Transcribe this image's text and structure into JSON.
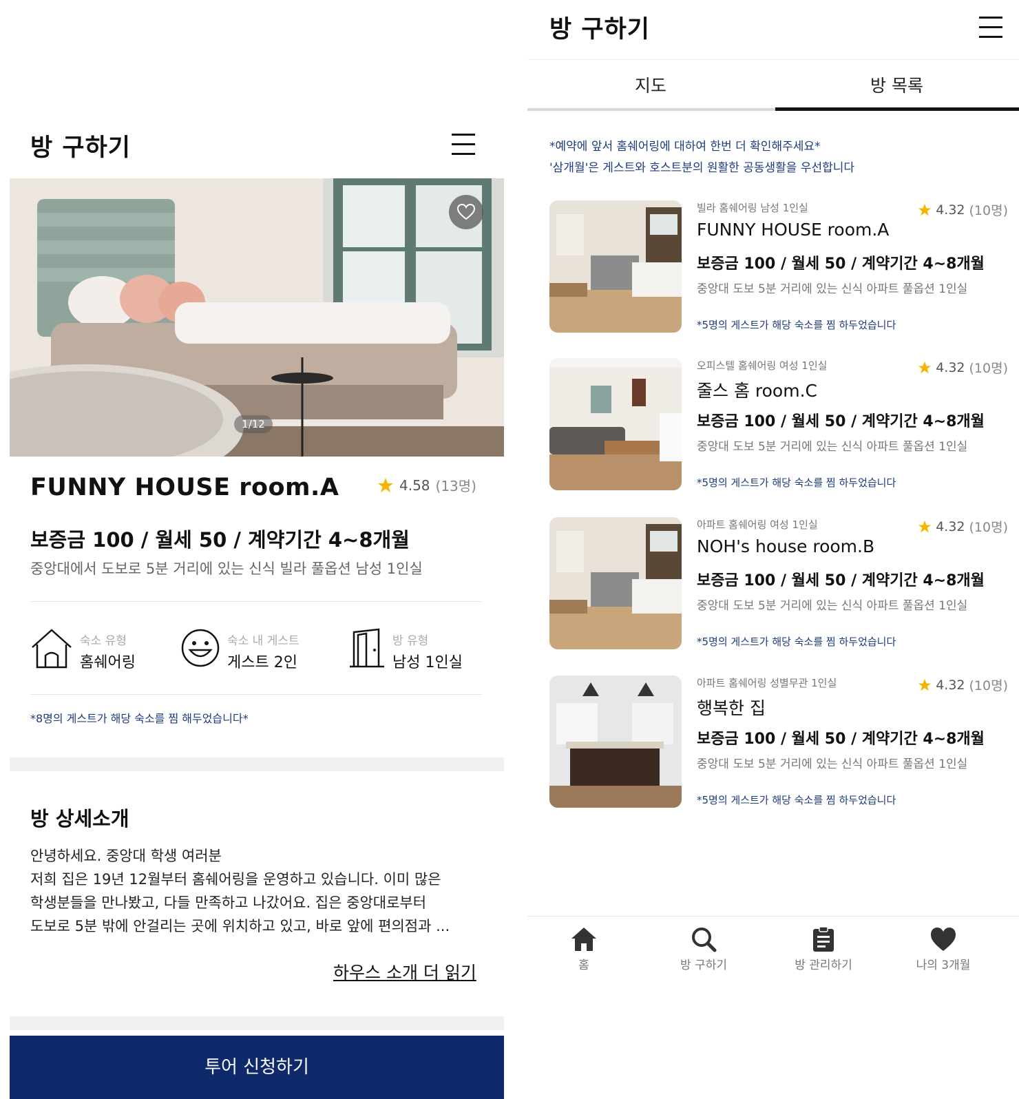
{
  "colors": {
    "accent": "#0e2a6a",
    "star": "#f5b400",
    "notice": "#1d3b80"
  },
  "detail": {
    "header_title": "방 구하기",
    "photo_indicator": "1/12",
    "room_name": "FUNNY HOUSE room.A",
    "rating": "4.58",
    "rating_count": "(13명)",
    "price": "보증금 100 / 월세 50 / 계약기간 4~8개월",
    "description": "중앙대에서 도보로 5분 거리에 있는 신식 빌라 풀옵션 남성 1인실",
    "features": [
      {
        "icon": "house-icon",
        "label": "숙소 유형",
        "value": "홈쉐어링"
      },
      {
        "icon": "smiley-icon",
        "label": "숙소 내 게스트",
        "value": "게스트 2인"
      },
      {
        "icon": "door-icon",
        "label": "방 유형",
        "value": "남성 1인실"
      }
    ],
    "wishlist_notice": "*8명의 게스트가 해당 숙소를 찜 해두었습니다*",
    "section_title": "방 상세소개",
    "body_lines": [
      "안녕하세요. 중앙대 학생 여러분",
      "저희 집은 19년 12월부터 홈쉐어링을 운영하고 있습니다. 이미 많은",
      "학생분들을 만나봤고, 다들 만족하고 나갔어요. 집은 중앙대로부터",
      "도보로 5분 밖에 안걸리는 곳에 위치하고 있고, 바로 앞에 편의점과 ..."
    ],
    "read_more": "하우스 소개 더 읽기",
    "tour_button": "투어 신청하기"
  },
  "list": {
    "header_title": "방 구하기",
    "tabs": [
      {
        "label": "지도",
        "active": false
      },
      {
        "label": "방 목록",
        "active": true
      }
    ],
    "notice_lines": [
      "*예약에 앞서 홈쉐어링에 대하여 한번 더 확인해주세요*",
      "'삼개월'은 게스트와 호스트분의 원활한 공동생활을 우선합니다"
    ],
    "rooms": [
      {
        "type": "빌라 홈쉐어링 남성 1인실",
        "rating": "4.32",
        "count": "(10명)",
        "name": "FUNNY HOUSE room.A",
        "price": "보증금 100 / 월세 50 / 계약기간 4~8개월",
        "desc": "중앙대 도보 5분 거리에 있는 신식 아파트 풀옵션 1인실",
        "note": "*5명의 게스트가 해당 숙소를 찜 하두었습니다"
      },
      {
        "type": "오피스텔 홈쉐어링 여성 1인실",
        "rating": "4.32",
        "count": "(10명)",
        "name": "줄스 홈 room.C",
        "price": "보증금 100 / 월세 50 / 계약기간 4~8개월",
        "desc": "중앙대 도보 5분 거리에 있는 신식 아파트 풀옵션 1인실",
        "note": "*5명의 게스트가 해당 숙소를 찜 하두었습니다"
      },
      {
        "type": "아파트 홈쉐어링 여성 1인실",
        "rating": "4.32",
        "count": "(10명)",
        "name": "NOH's house room.B",
        "price": "보증금 100 / 월세 50 / 계약기간 4~8개월",
        "desc": "중앙대 도보 5분 거리에 있는 신식 아파트 풀옵션 1인실",
        "note": "*5명의 게스트가 해당 숙소를 찜 하두었습니다"
      },
      {
        "type": "아파트 홈쉐어링 성별무관 1인실",
        "rating": "4.32",
        "count": "(10명)",
        "name": "행복한 집",
        "price": "보증금 100 / 월세 50 / 계약기간 4~8개월",
        "desc": "중앙대 도보 5분 거리에 있는 신식 아파트 풀옵션 1인실",
        "note": "*5명의 게스트가 해당 숙소를 찜 하두었습니다"
      }
    ],
    "nav": [
      {
        "icon": "home-icon",
        "label": "홈"
      },
      {
        "icon": "search-icon",
        "label": "방 구하기"
      },
      {
        "icon": "clipboard-icon",
        "label": "방 관리하기"
      },
      {
        "icon": "heart-icon",
        "label": "나의 3개월"
      }
    ]
  }
}
